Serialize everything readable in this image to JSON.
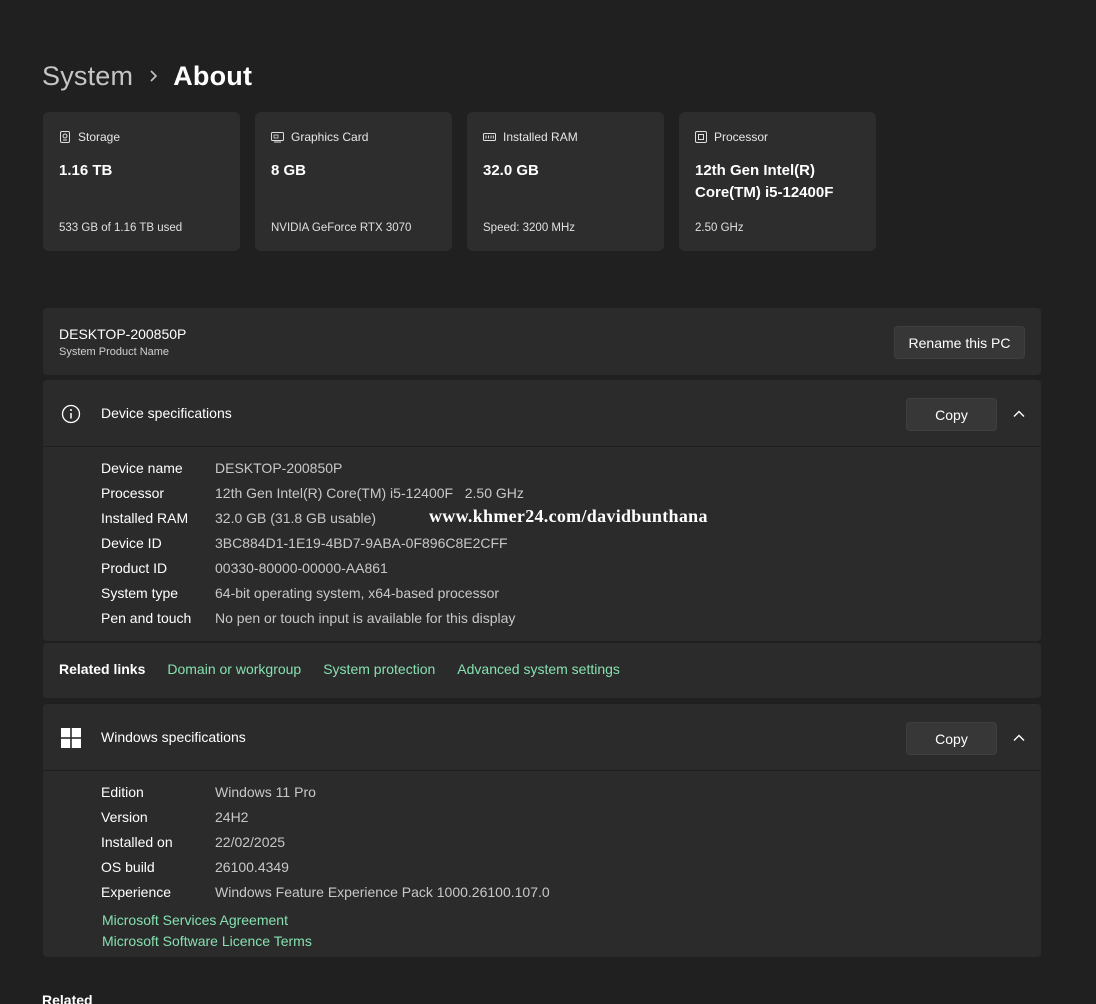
{
  "breadcrumb": {
    "parent": "System",
    "current": "About"
  },
  "cards": [
    {
      "icon": "storage-icon",
      "title": "Storage",
      "value": "1.16 TB",
      "sub": "533 GB of 1.16 TB used"
    },
    {
      "icon": "graphics-card-icon",
      "title": "Graphics Card",
      "value": "8 GB",
      "sub": "NVIDIA GeForce RTX 3070"
    },
    {
      "icon": "ram-icon",
      "title": "Installed RAM",
      "value": "32.0 GB",
      "sub": "Speed: 3200 MHz"
    },
    {
      "icon": "processor-icon",
      "title": "Processor",
      "value": "12th Gen Intel(R) Core(TM) i5-12400F",
      "sub": "2.50 GHz"
    }
  ],
  "pc": {
    "name": "DESKTOP-200850P",
    "sub": "System Product Name",
    "rename_label": "Rename this PC"
  },
  "device_specs": {
    "title": "Device specifications",
    "copy_label": "Copy",
    "rows": [
      {
        "label": "Device name",
        "value": "DESKTOP-200850P"
      },
      {
        "label": "Processor",
        "value": "12th Gen Intel(R) Core(TM) i5-12400F   2.50 GHz"
      },
      {
        "label": "Installed RAM",
        "value": "32.0 GB (31.8 GB usable)"
      },
      {
        "label": "Device ID",
        "value": "3BC884D1-1E19-4BD7-9ABA-0F896C8E2CFF"
      },
      {
        "label": "Product ID",
        "value": "00330-80000-00000-AA861"
      },
      {
        "label": "System type",
        "value": "64-bit operating system, x64-based processor"
      },
      {
        "label": "Pen and touch",
        "value": "No pen or touch input is available for this display"
      }
    ],
    "watermark": "www.khmer24.com/davidbunthana"
  },
  "related_links": {
    "title": "Related links",
    "links": [
      "Domain or workgroup",
      "System protection",
      "Advanced system settings"
    ]
  },
  "windows_specs": {
    "title": "Windows specifications",
    "copy_label": "Copy",
    "rows": [
      {
        "label": "Edition",
        "value": "Windows 11 Pro"
      },
      {
        "label": "Version",
        "value": "24H2"
      },
      {
        "label": "Installed on",
        "value": "22/02/2025"
      },
      {
        "label": "OS build",
        "value": "26100.4349"
      },
      {
        "label": "Experience",
        "value": "Windows Feature Experience Pack 1000.26100.107.0"
      }
    ],
    "links": [
      "Microsoft Services Agreement",
      "Microsoft Software Licence Terms"
    ]
  },
  "bottom_heading": "Related",
  "colors": {
    "background": "#202020",
    "panel": "#2b2b2b",
    "card": "#2d2d2d",
    "link": "#86e0b0"
  }
}
